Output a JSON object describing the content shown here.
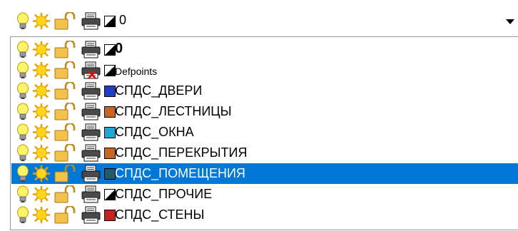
{
  "combo": {
    "value": "0",
    "swatch_color": "bw",
    "icons": [
      "lightbulb-on-icon",
      "sun-freeze-icon",
      "padlock-unlocked-icon",
      "printer-icon"
    ],
    "arrow_icon": "chevron-down-icon"
  },
  "layers": [
    {
      "name": "0",
      "color": "bw",
      "bold": true,
      "plot": true,
      "selected": false
    },
    {
      "name": "Defpoints",
      "color": "bw",
      "small": true,
      "plot": false,
      "selected": false
    },
    {
      "name": "СПДС_ДВЕРИ",
      "color": "#1f3fc8",
      "plot": true,
      "selected": false
    },
    {
      "name": "СПДС_ЛЕСТНИЦЫ",
      "color": "#c8661f",
      "plot": true,
      "selected": false
    },
    {
      "name": "СПДС_ОКНА",
      "color": "#1fa8d4",
      "plot": true,
      "selected": false
    },
    {
      "name": "СПДС_ПЕРЕКРЫТИЯ",
      "color": "#c8661f",
      "plot": true,
      "selected": false
    },
    {
      "name": "СПДС_ПОМЕЩЕНИЯ",
      "color": "#1f5a6e",
      "plot": true,
      "selected": true
    },
    {
      "name": "СПДС_ПРОЧИЕ",
      "color": "bw",
      "plot": true,
      "selected": false
    },
    {
      "name": "СПДС_СТЕНЫ",
      "color": "#c81f1f",
      "plot": true,
      "selected": false
    }
  ]
}
